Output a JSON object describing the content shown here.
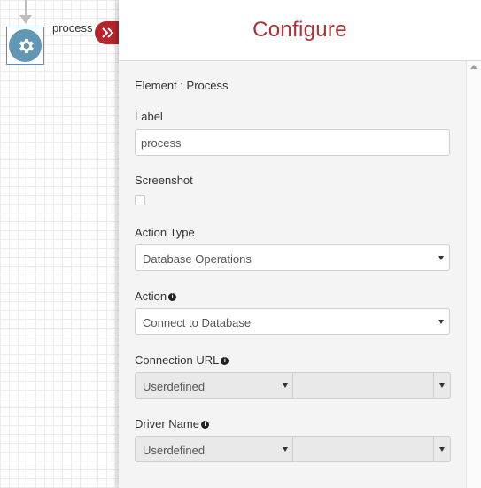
{
  "canvas": {
    "node_label": "process",
    "node_icon": "gear-icon",
    "collapse_icon": "double-chevron-right-icon"
  },
  "panel": {
    "title": "Configure",
    "element_line": "Element : Process",
    "label_field": {
      "label": "Label",
      "value": "process"
    },
    "screenshot": {
      "label": "Screenshot",
      "checked": false
    },
    "action_type": {
      "label": "Action Type",
      "selected": "Database Operations"
    },
    "action": {
      "label": "Action",
      "selected": "Connect to Database",
      "info_icon": "info-icon"
    },
    "connection_url": {
      "label": "Connection URL",
      "mode": "Userdefined",
      "value": "",
      "info_icon": "info-icon"
    },
    "driver_name": {
      "label": "Driver Name",
      "mode": "Userdefined",
      "value": "",
      "info_icon": "info-icon"
    }
  },
  "colors": {
    "accent": "#b5262c",
    "title": "#a8343a",
    "node": "#5f97b5",
    "node_border": "#4a90d9"
  }
}
